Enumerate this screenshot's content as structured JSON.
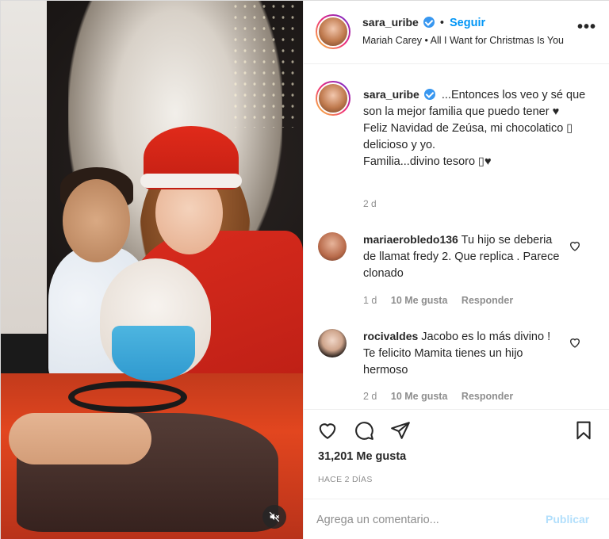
{
  "post": {
    "author": "sara_uribe",
    "follow_label": "Seguir",
    "separator": "•",
    "audio": "Mariah Carey • All I Want for Christmas Is You",
    "more_label": "•••"
  },
  "caption": {
    "author": "sara_uribe",
    "text_line1": "...Entonces los veo y sé que son la mejor familia que puedo tener ♥",
    "text_line2": "Feliz Navidad de Zeúsa, mi chocolatico ▯ delicioso y yo.",
    "text_line3": "Familia...divino tesoro ▯♥",
    "time": "2 d"
  },
  "comments": [
    {
      "author": "mariaerobledo136",
      "text": "Tu hijo se deberia de llamat fredy 2. Que replica . Parece clonado",
      "time": "1 d",
      "likes": "10 Me gusta",
      "reply_label": "Responder"
    },
    {
      "author": "rocivaldes",
      "text": "Jacobo es lo más divino ! Te felicito Mamita tienes un hijo hermoso",
      "time": "2 d",
      "likes": "10 Me gusta",
      "reply_label": "Responder"
    }
  ],
  "actions": {
    "icons": [
      "heart-icon",
      "comment-icon",
      "share-icon",
      "bookmark-icon"
    ],
    "likes": "31,201 Me gusta",
    "date": "HACE 2 DÍAS"
  },
  "comment_box": {
    "placeholder": "Agrega un comentario...",
    "post_label": "Publicar"
  },
  "media": {
    "mute_icon": "speaker-muted-icon"
  },
  "colors": {
    "accent": "#0095f6",
    "verified": "#3897f0",
    "post_disabled": "#b2dffc",
    "muted_text": "#8e8e8e"
  }
}
